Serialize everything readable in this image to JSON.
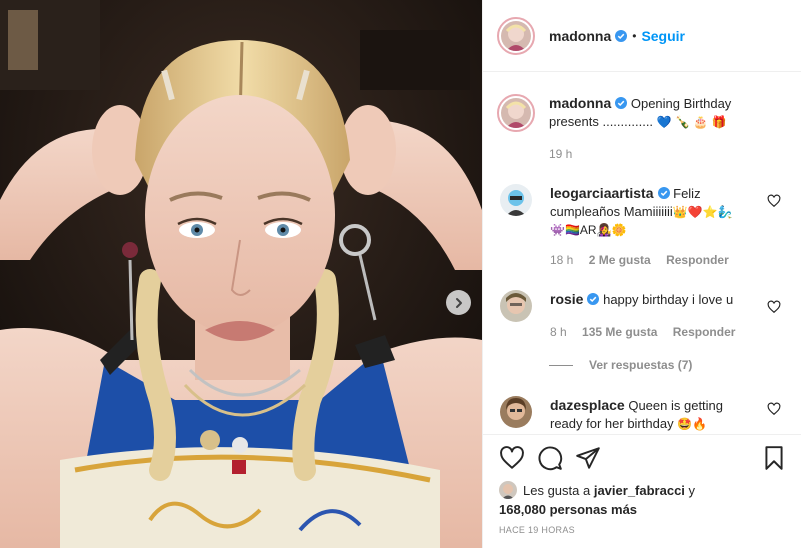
{
  "post": {
    "author": "madonna",
    "follow_label": "Seguir",
    "separator": "•",
    "caption_user": "madonna",
    "caption_text": "Opening Birthday presents ..............",
    "caption_emojis": "💙 🍾 🎂 🎁",
    "caption_time": "19 h"
  },
  "comments": [
    {
      "user": "leogarciaartista",
      "text": "Feliz cumpleaños Mamiiiiiii",
      "emojis": "👑❤️⭐🧞‍♂️ 👾🏳️‍🌈AR👩‍🎤🌼",
      "time": "18 h",
      "likes": "2 Me gusta",
      "reply": "Responder"
    },
    {
      "user": "rosie",
      "text": "happy birthday i love u",
      "time": "8 h",
      "likes": "135 Me gusta",
      "reply": "Responder"
    },
    {
      "user": "dazesplace",
      "text": "Queen is getting ready for her birthday",
      "emojis": "🤩🔥"
    }
  ],
  "view_replies": "Ver respuestas (7)",
  "likes": {
    "prefix": "Les gusta a",
    "user": "javier_fabracci",
    "conj": "y",
    "count": "168,080 personas más"
  },
  "timestamp": "HACE 19 HORAS",
  "icons": [
    "heart-icon",
    "comment-icon",
    "share-icon",
    "bookmark-icon",
    "verified-icon",
    "chevron-right-icon"
  ],
  "colors": {
    "link": "#0095f6",
    "verified": "#3897f0",
    "muted": "#8e8e8e",
    "text": "#262626"
  }
}
